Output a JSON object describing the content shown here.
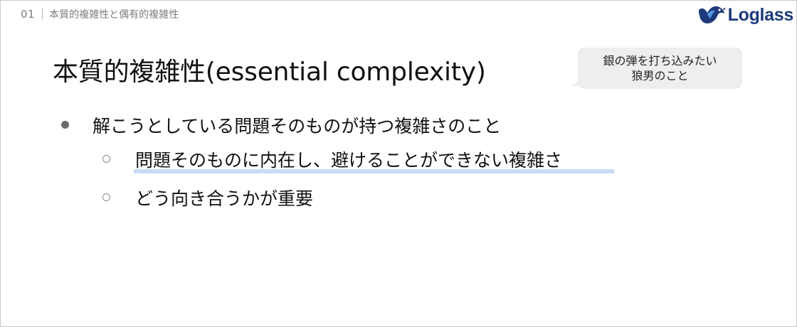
{
  "header": {
    "section_number": "01",
    "section_title": "本質的複雑性と偶有的複雑性"
  },
  "logo": {
    "icon": "loglass-bird-icon",
    "text": "Loglass",
    "color": "#1e3a7b"
  },
  "slide": {
    "title": "本質的複雑性(essential complexity)",
    "speech_bubble": {
      "line1": "銀の弾を打ち込みたい",
      "line2": "狼男のこと"
    },
    "bullets": [
      {
        "level": 1,
        "marker": "filled-dot",
        "text": "解こうとしている問題そのものが持つ複雑さのこと"
      },
      {
        "level": 2,
        "marker": "hollow-circle",
        "text": "問題そのものに内在し、避けることができない複雑さ",
        "highlighted": true,
        "highlight_color": "#c7dcf5"
      },
      {
        "level": 2,
        "marker": "hollow-circle",
        "text": "どう向き合うかが重要"
      }
    ]
  }
}
